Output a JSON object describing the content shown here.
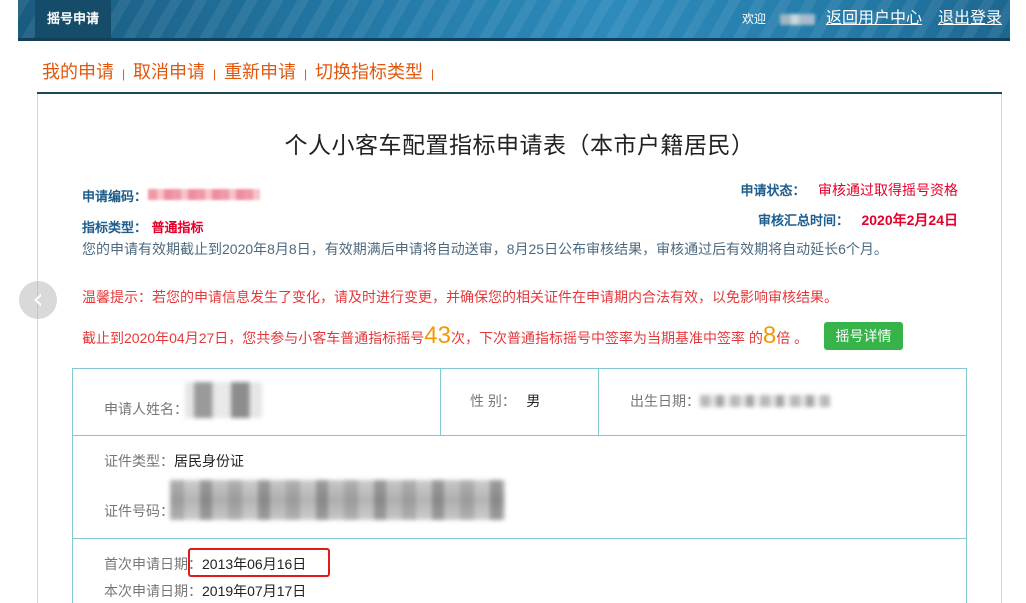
{
  "top_bar": {
    "tab_label": "摇号申请",
    "welcome": "欢迎",
    "user_center_link": "返回用户中心",
    "logout_link": "退出登录"
  },
  "nav": {
    "items": [
      "我的申请",
      "取消申请",
      "重新申请",
      "切换指标类型"
    ],
    "separator": "|"
  },
  "form": {
    "title": "个人小客车配置指标申请表（本市户籍居民）",
    "application_code_label": "申请编码：",
    "status_label": "申请状态：",
    "status_value": "审核通过取得摇号资格",
    "quota_type_label": "指标类型：",
    "quota_type_value": "普通指标",
    "review_time_label": "审核汇总时间：",
    "review_time_value": "2020年2月24日",
    "validity_notice": "您的申请有效期截止到2020年8月8日，有效期满后申请将自动送审，8月25日公布审核结果，审核通过后有效期将自动延长6个月。",
    "warm_tip": "温馨提示：若您的申请信息发生了变化，请及时进行变更，并确保您的相关证件在申请期内合法有效，以免影响审核结果。",
    "lottery_summary": {
      "prefix": "截止到2020年04月27日，您共参与小客车普通指标摇号",
      "count": "43",
      "middle": "次，下次普通指标摇号中签率为当期基准中签率 的",
      "multiplier": "8",
      "suffix": "倍 。",
      "details_button": "摇号详情"
    }
  },
  "applicant_table": {
    "name_label": "申请人姓名：",
    "gender_label": "性 别：",
    "gender_value": "男",
    "birth_date_label": "出生日期：",
    "id_type_label": "证件类型：",
    "id_type_value": "居民身份证",
    "id_number_label": "证件号码：",
    "first_application_date_label": "首次申请日期：",
    "first_application_date_value": "2013年06月16日",
    "current_application_date_label": "本次申请日期：",
    "current_application_date_value": "2019年07月17日"
  },
  "icons": {
    "carousel_prev": "chevron-left-icon"
  },
  "colors": {
    "topbar": "#1f6e98",
    "nav_link": "#e2570b",
    "status_red": "#e4002b",
    "tip_red": "#e4393c",
    "highlight_orange": "#f39800",
    "button_green": "#36b44a",
    "label_blue": "#1d5d8c",
    "table_border": "#86c5d3",
    "highlight_box": "#e0191b",
    "notice_text": "#4d6a80"
  }
}
